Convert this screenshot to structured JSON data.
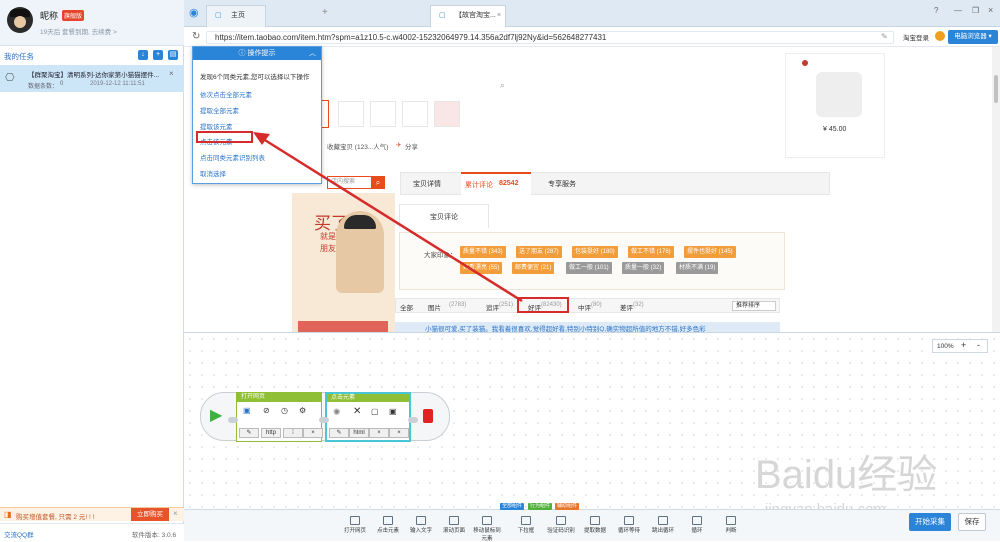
{
  "user": {
    "nickname": "昵称",
    "vip_badge": "旗舰版",
    "expiry_note": "19天后 套餐到期, 去续费 >"
  },
  "tasks": {
    "title": "我的任务",
    "item_title": "【群聚淘宝】清明系列-达你家第小猫猫摆件...",
    "item_count_label": "数据条数：",
    "item_count": "0",
    "item_time": "2019-12-12 11:11:51"
  },
  "promo": {
    "text": "购买增值套餐, 只需 2 元! ! !",
    "button": "立即购买"
  },
  "footer": {
    "qq": "交流QQ群",
    "version": "软件版本: 3.0.6"
  },
  "browser": {
    "tabs": [
      {
        "label": "主页"
      },
      {
        "label": "【故宫淘宝..."
      }
    ],
    "url": "https://item.taobao.com/item.htm?spm=a1z10.5-c.w4002-15232064979.14.356a2df7lj92Ny&id=562648277431",
    "login": "淘宝登录",
    "mode_btn": "电脑浏览器 ▾"
  },
  "product": {
    "collect": "收藏宝贝 (123...人气)",
    "share": "分享",
    "price": "¥ 45.00",
    "search_placeholder": "店内搜索"
  },
  "review_tabs": {
    "detail": "宝贝详情",
    "reviews": "累计评论",
    "review_count": "82542",
    "service": "专享服务",
    "sub": "宝贝评论",
    "impression": "大家印象："
  },
  "tags": [
    "质量不错 (343)",
    "送了朋友 (287)",
    "包装挺好 (180)",
    "做工不错 (176)",
    "摆件也挺好 (145)",
    "好看漂亮 (55)",
    "邮费便宜 (21)",
    "做工一般 (101)",
    "质量一般 (32)",
    "材质不满 (19)"
  ],
  "filter": {
    "all": "全部",
    "pic": "图片",
    "pic_n": "(2783)",
    "add": "追评",
    "add_n": "(251)",
    "good": "好评",
    "good_n": "(82430)",
    "mid": "中评",
    "mid_n": "(80)",
    "bad": "差评",
    "bad_n": "(32)",
    "sort": "推荐排序"
  },
  "review_text": "小猫很可爱,买了装猫。我看着很喜欢,觉得超好看,特别小特别Q,确实物超所值的地方不错,好多色彩",
  "banner": {
    "big": "买了",
    "line2": "就是",
    "line3": "朋友"
  },
  "popup": {
    "title": "操作提示",
    "intro": "发现6个同类元素,您可以选择以下操作",
    "options": [
      "依次点击全部元素",
      "提取全部元素",
      "提取该元素",
      "点击该元素",
      "点击同类元素识别列表",
      "取消选择"
    ]
  },
  "designer": {
    "zoom": "100%",
    "plus": "+",
    "minus": "-"
  },
  "nodes": {
    "open": {
      "title": "打开网页",
      "field": "http"
    },
    "click": {
      "title": "点击元素",
      "field": "html"
    }
  },
  "chips": [
    {
      "label": "全部组件",
      "color": "#2a84d8"
    },
    {
      "label": "行为组件",
      "color": "#52b13c"
    },
    {
      "label": "辅助组件",
      "color": "#e8762b"
    }
  ],
  "tools": [
    "打开网页",
    "点击元素",
    "输入文字",
    "滚动页面",
    "移动鼠标到元素",
    "下拉框",
    "验证码识别",
    "提取数据",
    "循环等待",
    "跳出循环",
    "循环",
    "判断"
  ],
  "actions": {
    "start": "开始采集",
    "save": "保存"
  },
  "watermark": {
    "brand": "Baidu经验",
    "sub": "jingyan.baidu.com"
  }
}
